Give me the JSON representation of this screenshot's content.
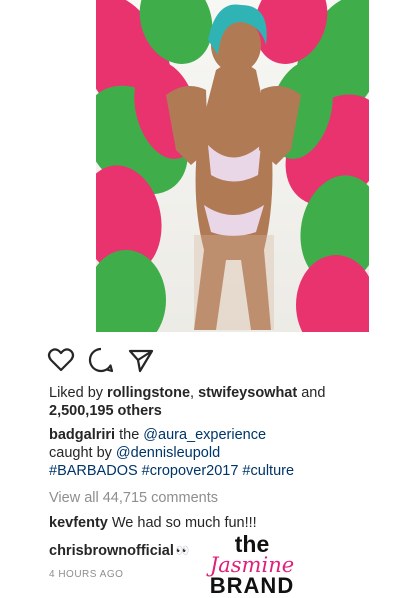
{
  "post": {
    "image_alt": "photo-of-carnival-costume",
    "actions": [
      "heart-icon",
      "comment-icon",
      "share-icon"
    ],
    "likes": {
      "prefix": "Liked by ",
      "user1": "rollingstone",
      "separator": ", ",
      "user2": "stwifeysowhat",
      "and": " and",
      "count": "2,500,195 others"
    },
    "caption": {
      "user": "badgalriri",
      "text1": " the ",
      "mention1": "@aura_experience",
      "text2": "caught by ",
      "mention2": "@dennisleupold",
      "hashtags": "#BARBADOS #cropover2017 #culture"
    },
    "view_all": "View all 44,715 comments",
    "comments": [
      {
        "user": "kevfenty",
        "text": " We had so much fun!!!"
      },
      {
        "user": "chrisbrownofficial",
        "text": "👀"
      }
    ],
    "time": "4 HOURS AGO"
  },
  "watermark": {
    "line1": "the",
    "line2": "Jasmine",
    "line3": "BRAND"
  },
  "colors": {
    "link": "#003569",
    "muted": "#8e8e8e",
    "text": "#262626",
    "feather_green": "#3fae4a",
    "feather_pink": "#e8336f",
    "hair_teal": "#2fb3b5"
  }
}
